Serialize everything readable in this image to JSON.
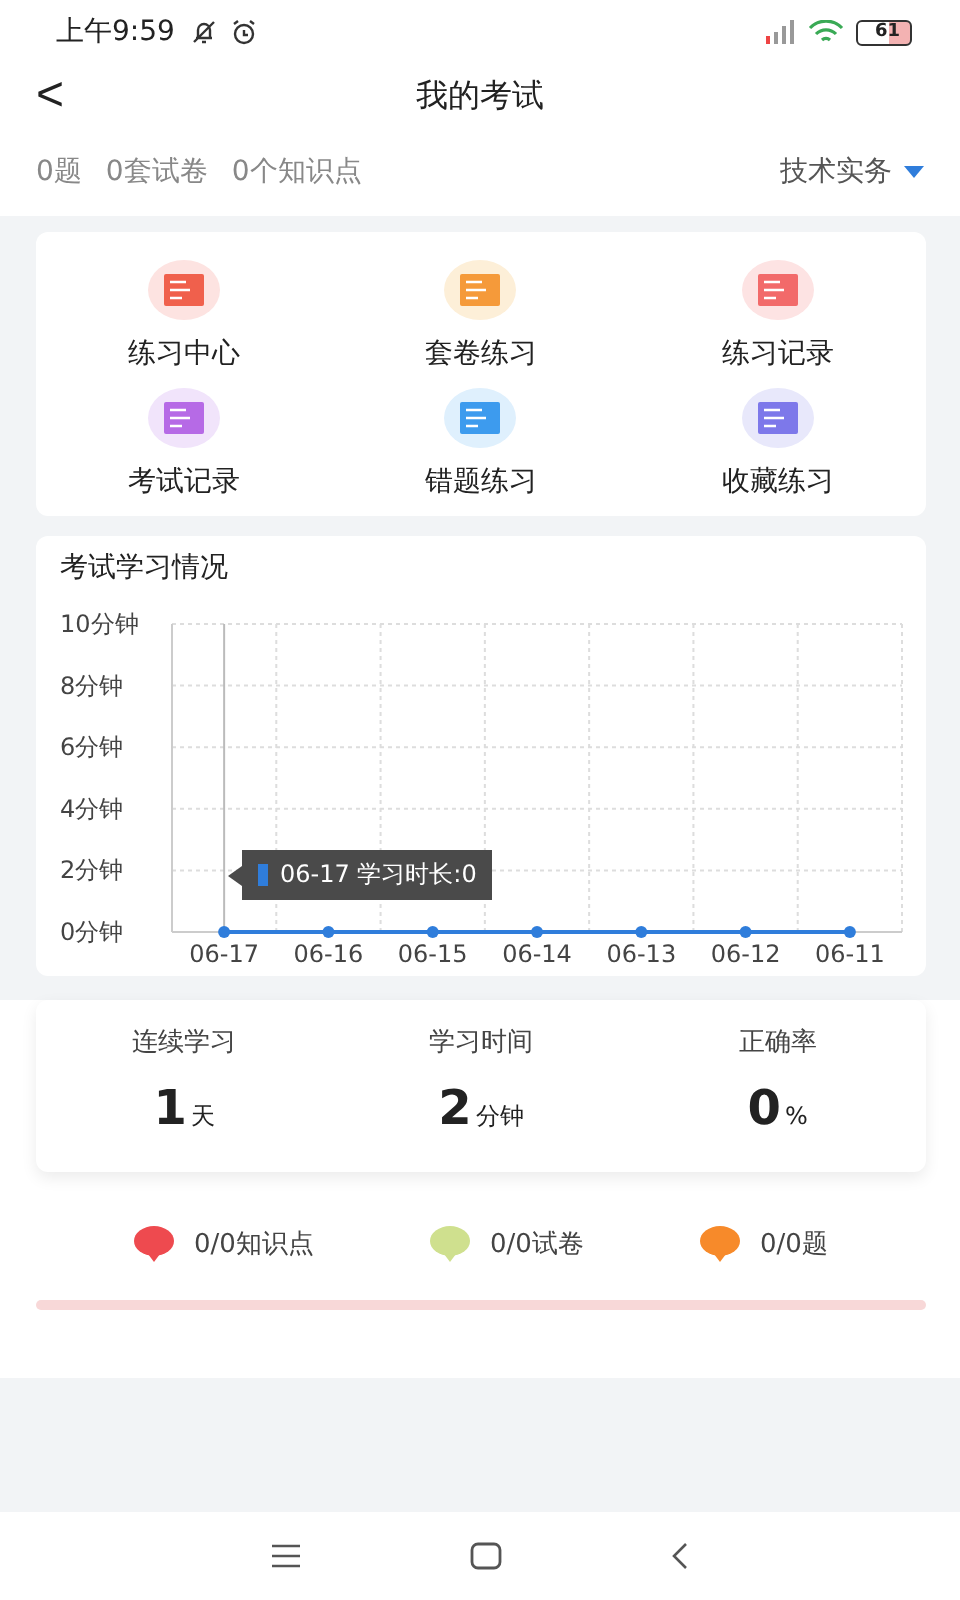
{
  "status_bar": {
    "time": "上午9:59",
    "battery": "61"
  },
  "header": {
    "back": "<",
    "title": "我的考试"
  },
  "summary": {
    "items": [
      "0题",
      "0套试卷",
      "0个知识点"
    ],
    "subject": "技术实务"
  },
  "menu": [
    {
      "label": "练习中心"
    },
    {
      "label": "套卷练习"
    },
    {
      "label": "练习记录"
    },
    {
      "label": "考试记录"
    },
    {
      "label": "错题练习"
    },
    {
      "label": "收藏练习"
    }
  ],
  "chart_card": {
    "title": "考试学习情况",
    "tooltip": "06-17 学习时长:0",
    "chart_data": {
      "type": "line",
      "categories": [
        "06-17",
        "06-16",
        "06-15",
        "06-14",
        "06-13",
        "06-12",
        "06-11"
      ],
      "series": [
        {
          "color": "#2f7ddb",
          "marker": true,
          "values": [
            0,
            0,
            0,
            0,
            0,
            0,
            0
          ]
        }
      ],
      "grid": true,
      "ref_lines": [
        {
          "axis": "x",
          "value": "06-17"
        }
      ],
      "ylim": [
        0,
        10
      ],
      "yticks": [
        {
          "value": 0,
          "label": "0分钟"
        },
        {
          "value": 2,
          "label": "2分钟"
        },
        {
          "value": 4,
          "label": "4分钟"
        },
        {
          "value": 6,
          "label": "6分钟"
        },
        {
          "value": 8,
          "label": "8分钟"
        },
        {
          "value": 10,
          "label": "10分钟"
        }
      ]
    }
  },
  "stats": [
    {
      "label": "连续学习",
      "value": "1",
      "unit": "天"
    },
    {
      "label": "学习时间",
      "value": "2",
      "unit": "分钟"
    },
    {
      "label": "正确率",
      "value": "0",
      "unit": "%"
    }
  ],
  "legend": [
    {
      "label": "0/0知识点",
      "color": "#ee4a4f"
    },
    {
      "label": "0/0试卷",
      "color": "#cfe08e"
    },
    {
      "label": "0/0题",
      "color": "#f78a2a"
    }
  ],
  "progress": {
    "level": 0
  }
}
